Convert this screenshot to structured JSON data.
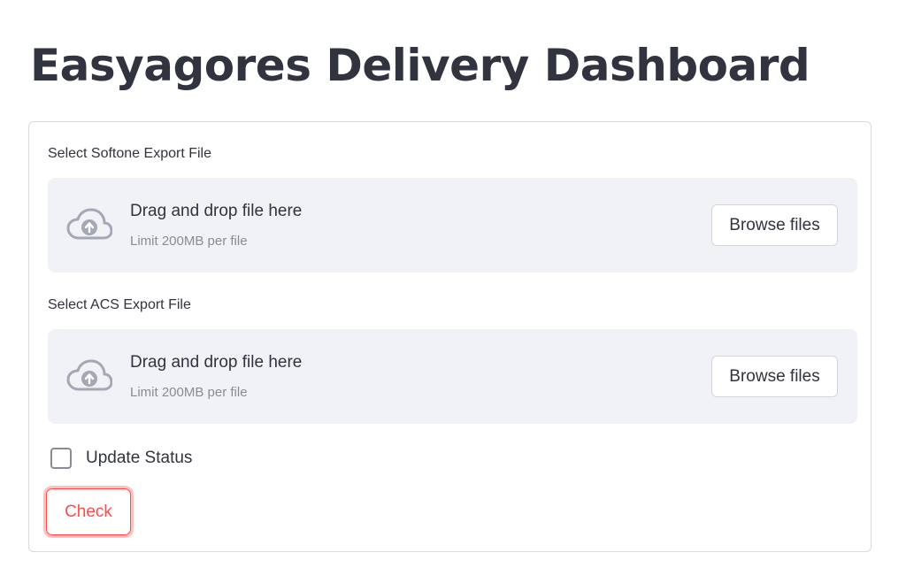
{
  "page": {
    "title": "Easyagores Delivery Dashboard"
  },
  "uploaders": [
    {
      "label": "Select Softone Export File",
      "drop_text": "Drag and drop file here",
      "limit_text": "Limit 200MB per file",
      "browse_label": "Browse files",
      "icon": "cloud-upload-icon"
    },
    {
      "label": "Select ACS Export File",
      "drop_text": "Drag and drop file here",
      "limit_text": "Limit 200MB per file",
      "browse_label": "Browse files",
      "icon": "cloud-upload-icon"
    }
  ],
  "update_status": {
    "label": "Update Status",
    "checked": false
  },
  "check_button": {
    "label": "Check"
  },
  "colors": {
    "accent": "#ff4b4b",
    "text": "#31333f",
    "dropzone_bg": "#f0f2f6",
    "muted": "#8a8c95"
  }
}
